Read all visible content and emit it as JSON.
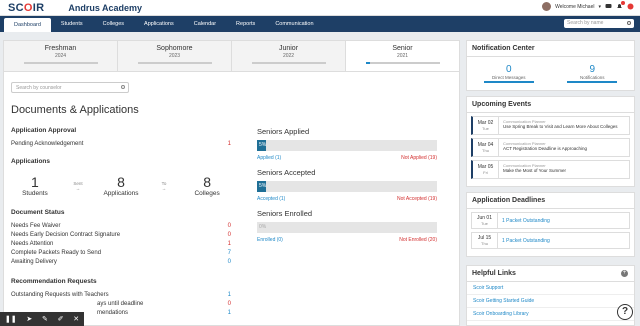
{
  "app": {
    "logo_prefix": "SC",
    "logo_o": "O",
    "logo_suffix": "IR",
    "school": "Andrus Academy"
  },
  "user": {
    "welcome": "Welcome Michael",
    "caret": "▾"
  },
  "nav": {
    "tabs": [
      "Dashboard",
      "Students",
      "Colleges",
      "Applications",
      "Calendar",
      "Reports",
      "Communication"
    ],
    "search_placeholder": "Search by name"
  },
  "years": [
    {
      "name": "Freshman",
      "year": "2024",
      "progress": 0
    },
    {
      "name": "Sophomore",
      "year": "2023",
      "progress": 0
    },
    {
      "name": "Junior",
      "year": "2022",
      "progress": 0
    },
    {
      "name": "Senior",
      "year": "2021",
      "progress": 0.06
    }
  ],
  "counselor_placeholder": "Search by counselor",
  "page_title": "Documents & Applications",
  "approval": {
    "title": "Application Approval",
    "label": "Pending Acknowledgement",
    "value": "1"
  },
  "applications": {
    "title": "Applications",
    "students": "1",
    "students_label": "Students",
    "sent": "Sent",
    "apps": "8",
    "apps_label": "Applications",
    "to": "To",
    "colleges": "8",
    "colleges_label": "Colleges"
  },
  "docstatus": {
    "title": "Document Status",
    "rows": [
      {
        "label": "Needs Fee Waiver",
        "value": "0"
      },
      {
        "label": "Needs Early Decision Contract Signature",
        "value": "0"
      },
      {
        "label": "Needs Attention",
        "value": "1"
      },
      {
        "label": "Complete Packets Ready to Send",
        "value": "7"
      },
      {
        "label": "Awaiting Delivery",
        "value": "0"
      }
    ]
  },
  "recs": {
    "title": "Recommendation Requests",
    "rows": [
      {
        "label": "Outstanding Requests with Teachers",
        "value": "1"
      },
      {
        "label": "ays until deadline",
        "value": "0"
      },
      {
        "label": "mendations",
        "value": "1"
      }
    ]
  },
  "progress": [
    {
      "title": "Seniors Applied",
      "pct": "5%",
      "frac": 0.05,
      "left": "Applied (1)",
      "right": "Not Applied (19)"
    },
    {
      "title": "Seniors Accepted",
      "pct": "5%",
      "frac": 0.05,
      "left": "Accepted (1)",
      "right": "Not Accepted (19)"
    },
    {
      "title": "Seniors Enrolled",
      "pct": "0%",
      "frac": 0,
      "left": "Enrolled (0)",
      "right": "Not Enrolled (20)"
    }
  ],
  "notification_center": {
    "title": "Notification Center",
    "direct": "0",
    "direct_label": "Direct Messages",
    "notes": "9",
    "notes_label": "Notifications"
  },
  "events": {
    "title": "Upcoming Events",
    "items": [
      {
        "date": "Mar 02",
        "day": "Tue",
        "cat": "Communication Planner",
        "text": "Use Spring Break to Visit and Learn More About Colleges"
      },
      {
        "date": "Mar 04",
        "day": "Thu",
        "cat": "Communication Planner",
        "text": "ACT Registration Deadline is Approaching"
      },
      {
        "date": "Mar 05",
        "day": "Fri",
        "cat": "Communication Planner",
        "text": "Make the Most of Your Summer"
      }
    ]
  },
  "deadlines": {
    "title": "Application Deadlines",
    "items": [
      {
        "date": "Jun 01",
        "day": "Tue",
        "text": "1 Packet Outstanding"
      },
      {
        "date": "Jul 15",
        "day": "Thu",
        "text": "1 Packet Outstanding"
      }
    ]
  },
  "links": {
    "title": "Helpful Links",
    "items": [
      "Scoir Support",
      "Scoir Getting Started Guide",
      "Scoir Onboarding Library"
    ]
  },
  "help": "?",
  "colors": {
    "navy": "#1e3f66",
    "blue": "#1e88c7",
    "red": "#d32f2f"
  }
}
